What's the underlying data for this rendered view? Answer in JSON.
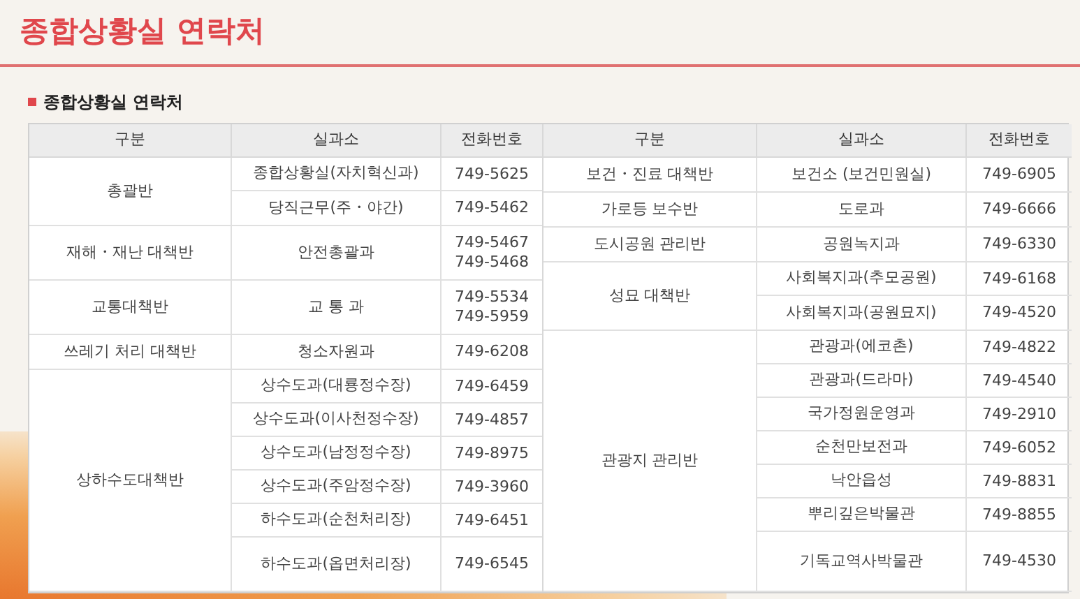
{
  "page_title": "종합상황실 연락처",
  "section_title": "종합상황실 연락처",
  "left_columns": [
    "구분",
    "실과소",
    "전화번호"
  ],
  "right_columns": [
    "구분",
    "실과소",
    "전화번호"
  ],
  "left_groups": [
    {
      "category": "총괄반",
      "entries": [
        {
          "office": "종합상황실(자치혁신과)",
          "phones": [
            "749-5625"
          ]
        },
        {
          "office": "당직근무(주・야간)",
          "phones": [
            "749-5462"
          ]
        }
      ]
    },
    {
      "category": "재해・재난 대책반",
      "entries": [
        {
          "office": "안전총괄과",
          "phones": [
            "749-5467",
            "749-5468"
          ]
        }
      ]
    },
    {
      "category": "교통대책반",
      "entries": [
        {
          "office": "교 통 과",
          "phones": [
            "749-5534",
            "749-5959"
          ]
        }
      ]
    },
    {
      "category": "쓰레기 처리 대책반",
      "entries": [
        {
          "office": "청소자원과",
          "phones": [
            "749-6208"
          ]
        }
      ]
    },
    {
      "category": "상하수도대책반",
      "entries": [
        {
          "office": "상수도과(대룡정수장)",
          "phones": [
            "749-6459"
          ]
        },
        {
          "office": "상수도과(이사천정수장)",
          "phones": [
            "749-4857"
          ]
        },
        {
          "office": "상수도과(남정정수장)",
          "phones": [
            "749-8975"
          ]
        },
        {
          "office": "상수도과(주암정수장)",
          "phones": [
            "749-3960"
          ]
        },
        {
          "office": "하수도과(순천처리장)",
          "phones": [
            "749-6451"
          ]
        },
        {
          "office": "하수도과(옵면처리장)",
          "phones": [
            "749-6545"
          ]
        }
      ]
    }
  ],
  "right_groups": [
    {
      "category": "보건・진료 대책반",
      "entries": [
        {
          "office": "보건소 (보건민원실)",
          "phones": [
            "749-6905"
          ]
        }
      ]
    },
    {
      "category": "가로등 보수반",
      "entries": [
        {
          "office": "도로과",
          "phones": [
            "749-6666"
          ]
        }
      ]
    },
    {
      "category": "도시공원 관리반",
      "entries": [
        {
          "office": "공원녹지과",
          "phones": [
            "749-6330"
          ]
        }
      ]
    },
    {
      "category": "성묘 대책반",
      "entries": [
        {
          "office": "사회복지과(추모공원)",
          "phones": [
            "749-6168"
          ]
        },
        {
          "office": "사회복지과(공원묘지)",
          "phones": [
            "749-4520"
          ]
        }
      ]
    },
    {
      "category": "관광지 관리반",
      "entries": [
        {
          "office": "관광과(에코촌)",
          "phones": [
            "749-4822"
          ]
        },
        {
          "office": "관광과(드라마)",
          "phones": [
            "749-4540"
          ]
        },
        {
          "office": "국가정원운영과",
          "phones": [
            "749-2910"
          ]
        },
        {
          "office": "순천만보전과",
          "phones": [
            "749-6052"
          ]
        },
        {
          "office": "낙안읍성",
          "phones": [
            "749-8831"
          ]
        },
        {
          "office": "뿌리깊은박물관",
          "phones": [
            "749-8855"
          ]
        },
        {
          "office": "기독교역사박물관",
          "phones": [
            "749-4530"
          ]
        }
      ]
    }
  ]
}
